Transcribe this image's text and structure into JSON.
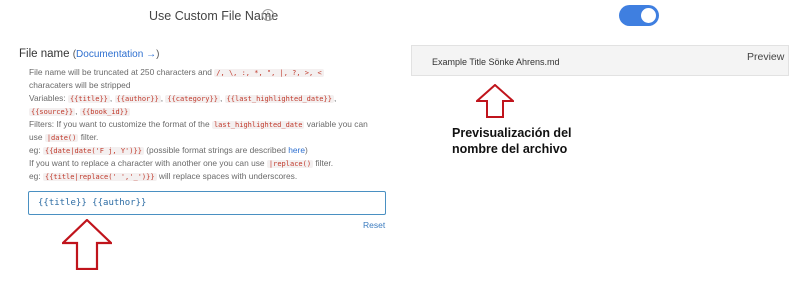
{
  "settings": {
    "custom_file_name_label": "Use Custom File Name",
    "info_icon": "info-icon",
    "toggle_enabled": true,
    "toggle_color": "#3f7fe0"
  },
  "file_name": {
    "label": "File name",
    "paren_open": "(",
    "documentation_link": "Documentation →",
    "paren_close": ")"
  },
  "help": {
    "line1_a": "File name will be truncated at 250 characters and",
    "chars_token": "/, \\, :, *, \", |, ?, >, <",
    "line2": "characaters will be stripped",
    "variables_label": "Variables:",
    "vars": [
      "{{title}}",
      "{{author}}",
      "{{category}}",
      "{{last_highlighted_date}}",
      "{{source}}",
      "{{book_id}}"
    ],
    "filters_a": "Filters: If you want to customize the format of the",
    "filters_token": "last_highlighted_date",
    "filters_b": "variable you can",
    "use_a": "use",
    "date_token": "|date()",
    "use_b": "filter.",
    "eg_label": "eg:",
    "date_example": "{{date|date('F j, Y')}}",
    "date_desc": "(possible format strings are described",
    "here_link": "here",
    "date_desc_close": ")",
    "replace_a": "If you want to replace a character with another one you can use",
    "replace_token": "|replace()",
    "replace_b": "filter.",
    "replace_example": "{{title|replace(' ','_')}}",
    "replace_desc": "will replace spaces with underscores."
  },
  "template_input": {
    "value": "{{title}} {{author}}"
  },
  "reset_label": "Reset",
  "preview": {
    "text": "Example Title Sönke Ahrens.md",
    "label": "Preview"
  },
  "annotation": {
    "line1": "Previsualización del",
    "line2": "nombre del archivo",
    "arrow_color": "#c0141c"
  }
}
